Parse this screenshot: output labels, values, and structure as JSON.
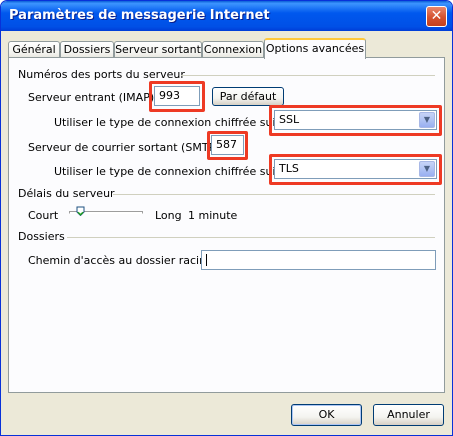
{
  "window": {
    "title": "Paramètres de messagerie Internet",
    "close_symbol": "✕"
  },
  "tabs": [
    {
      "label": "Général",
      "active": false
    },
    {
      "label": "Dossiers",
      "active": false
    },
    {
      "label": "Serveur sortant",
      "active": false
    },
    {
      "label": "Connexion",
      "active": false
    },
    {
      "label": "Options avancées",
      "active": true
    }
  ],
  "ports": {
    "group_label": "Numéros des ports du serveur",
    "incoming_label": "Serveur entrant (IMAP) :",
    "incoming_value": "993",
    "default_button": "Par défaut",
    "incoming_encryption_label": "Utiliser le type de connexion chiffrée suivant :",
    "incoming_encryption_value": "SSL",
    "outgoing_label": "Serveur de courrier sortant (SMTP) :",
    "outgoing_value": "587",
    "outgoing_encryption_label": "Utiliser le type de connexion chiffrée suivant :",
    "outgoing_encryption_value": "TLS"
  },
  "timeouts": {
    "group_label": "Délais du serveur",
    "short_label": "Court",
    "long_label": "Long",
    "value_label": "1 minute",
    "slider_fraction": 0.05
  },
  "folders": {
    "group_label": "Dossiers",
    "root_path_label": "Chemin d'accès au dossier racine :",
    "root_path_value": ""
  },
  "buttons": {
    "ok": "OK",
    "cancel": "Annuler"
  },
  "colors": {
    "highlight": "#ee3a24",
    "titlebar": "#0058ee",
    "dialog_bg": "#ece9d8"
  }
}
